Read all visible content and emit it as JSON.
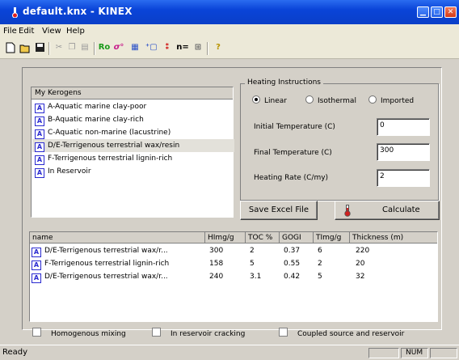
{
  "window": {
    "title": "default.knx - KINEX",
    "min_glyph": "▁",
    "max_glyph": "□",
    "close_glyph": "✕"
  },
  "menu": [
    "File",
    "Edit",
    "View",
    "Help"
  ],
  "toolbar": {
    "icons": [
      "new-icon",
      "open-icon",
      "save-icon",
      "cut-icon",
      "copy-icon",
      "paste-icon",
      "ro-icon",
      "oil-icon",
      "chart-icon",
      "add-icon",
      "tmax-icon",
      "n-icon",
      "grid-icon",
      "help-icon"
    ],
    "ro_label": "Ro",
    "n_label": "n="
  },
  "kerogens": {
    "header": "My Kerogens",
    "items": [
      "A-Aquatic marine clay-poor",
      "B-Aquatic marine clay-rich",
      "C-Aquatic non-marine (lacustrine)",
      "D/E-Terrigenous terrestrial wax/resin",
      "F-Terrigenous terrestrial lignin-rich",
      "In Reservoir"
    ],
    "selected_index": 3
  },
  "heating": {
    "group_label": "Heating Instructions",
    "modes": [
      "Linear",
      "Isothermal",
      "Imported"
    ],
    "selected_mode": "Linear",
    "initial_label": "Initial Temperature (C)",
    "initial_value": "0",
    "final_label": "Final Temperature (C)",
    "final_value": "300",
    "rate_label": "Heating Rate (C/my)",
    "rate_value": "2"
  },
  "buttons": {
    "save_excel": "Save Excel File",
    "calculate": "Calculate"
  },
  "table": {
    "columns": [
      "name",
      "HImg/g",
      "TOC %",
      "GOGI",
      "TImg/g",
      "Thickness (m)"
    ],
    "rows": [
      [
        "D/E-Terrigenous terrestrial wax/r...",
        "300",
        "2",
        "0.37",
        "6",
        "220"
      ],
      [
        "F-Terrigenous terrestrial lignin-rich",
        "158",
        "5",
        "0.55",
        "2",
        "20"
      ],
      [
        "D/E-Terrigenous terrestrial wax/r...",
        "240",
        "3.1",
        "0.42",
        "5",
        "32"
      ]
    ]
  },
  "options": [
    "Homogenous mixing",
    "In reservoir cracking",
    "Coupled source and reservoir"
  ],
  "status": {
    "text": "Ready",
    "num": "NUM"
  },
  "colors": {
    "titlebar": "#0a44d8",
    "selected_row": "#e3e1da",
    "kerogen_icon": "#2a2ad0"
  }
}
